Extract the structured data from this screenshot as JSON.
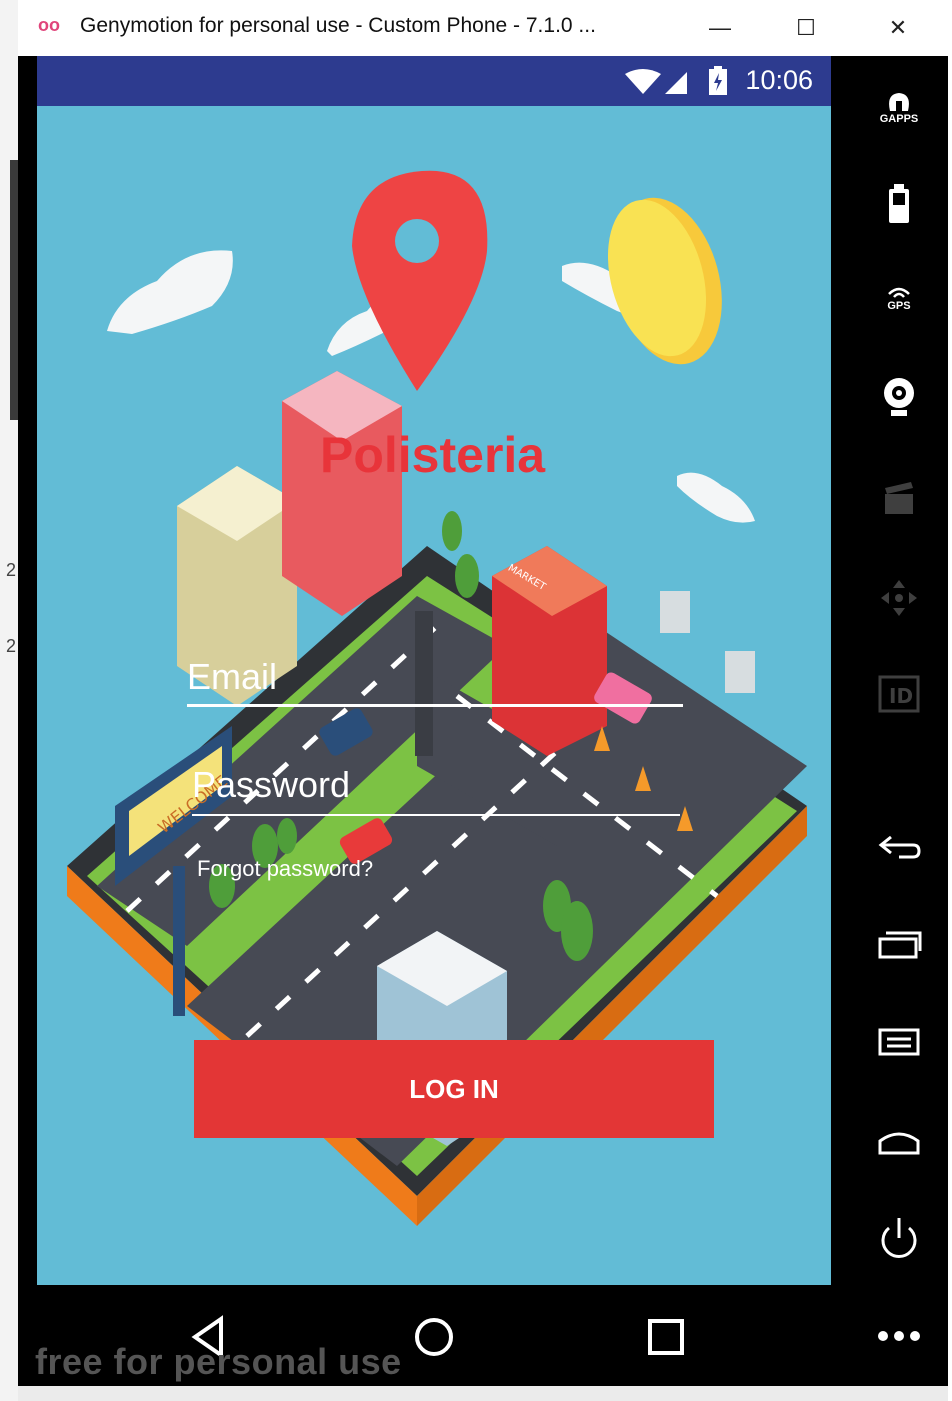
{
  "window": {
    "title": "Genymotion for personal use - Custom Phone - 7.1.0 ...",
    "minimize_glyph": "—",
    "maximize_glyph": "☐",
    "close_glyph": "✕"
  },
  "host": {
    "fragment_1": "2",
    "fragment_2": "2"
  },
  "statusbar": {
    "time": "10:06"
  },
  "app": {
    "brand": "Polisteria",
    "email_placeholder": "Email",
    "password_placeholder": "Password",
    "forgot_password": "Forgot password?",
    "login_button": "LOG IN",
    "illustration_text_welcome": "WELCOME",
    "illustration_text_market": "MARKET"
  },
  "toolbar": {
    "items": [
      {
        "icon": "gapps-icon",
        "label": "GAPPS"
      },
      {
        "icon": "battery-icon",
        "label": ""
      },
      {
        "icon": "gps-icon",
        "label": "GPS"
      },
      {
        "icon": "webcam-icon",
        "label": ""
      },
      {
        "icon": "clapper-icon",
        "label": ""
      },
      {
        "icon": "dpad-icon",
        "label": ""
      },
      {
        "icon": "id-icon",
        "label": "ID"
      },
      {
        "icon": "back-icon",
        "label": ""
      },
      {
        "icon": "recents-icon",
        "label": ""
      },
      {
        "icon": "menu-icon",
        "label": ""
      },
      {
        "icon": "home-icon",
        "label": ""
      },
      {
        "icon": "power-icon",
        "label": ""
      },
      {
        "icon": "more-icon",
        "label": ""
      }
    ]
  },
  "watermark": "free for personal use",
  "colors": {
    "statusbar": "#2d3b8f",
    "sky": "#62bcd6",
    "accent_red": "#e33636",
    "grass": "#7cc244",
    "road": "#474a54"
  }
}
